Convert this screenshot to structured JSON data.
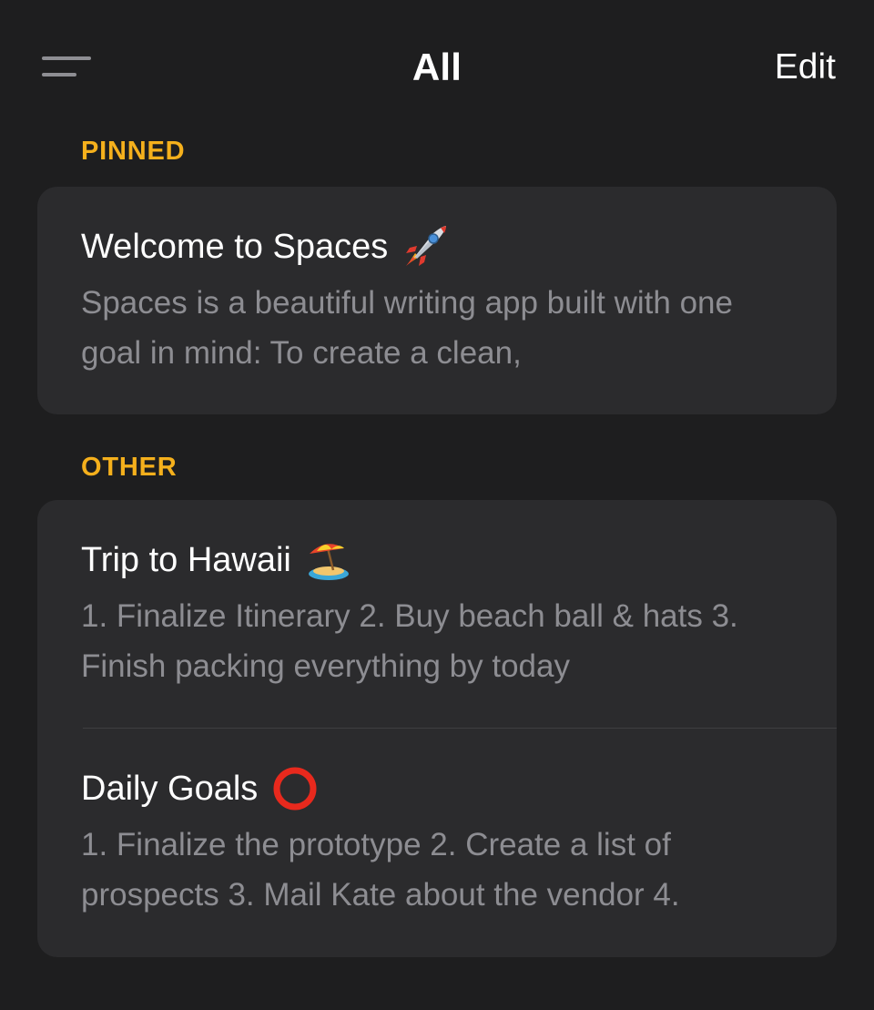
{
  "nav": {
    "title": "All",
    "edit_label": "Edit",
    "menu_icon": "hamburger-menu-icon"
  },
  "sections": {
    "pinned": {
      "header": "PINNED",
      "notes": [
        {
          "title": "Welcome to Spaces",
          "emoji": "rocket-icon",
          "preview": "Spaces is a beautiful writing app built with one goal in mind: To create a clean,"
        }
      ]
    },
    "other": {
      "header": "OTHER",
      "notes": [
        {
          "title": "Trip to Hawaii",
          "emoji": "island-umbrella-icon",
          "preview": "1. Finalize Itinerary 2. Buy beach ball & hats 3. Finish packing everything by today"
        },
        {
          "title": "Daily Goals",
          "emoji": "red-circle-icon",
          "preview": "1. Finalize the prototype 2. Create a list of prospects 3. Mail Kate about the vendor 4."
        }
      ]
    }
  },
  "colors": {
    "background": "#1e1e1f",
    "card": "#2b2b2d",
    "section_header": "#f5b01c",
    "preview_text": "#8d8d92",
    "menu_icon": "#8e8e93"
  }
}
